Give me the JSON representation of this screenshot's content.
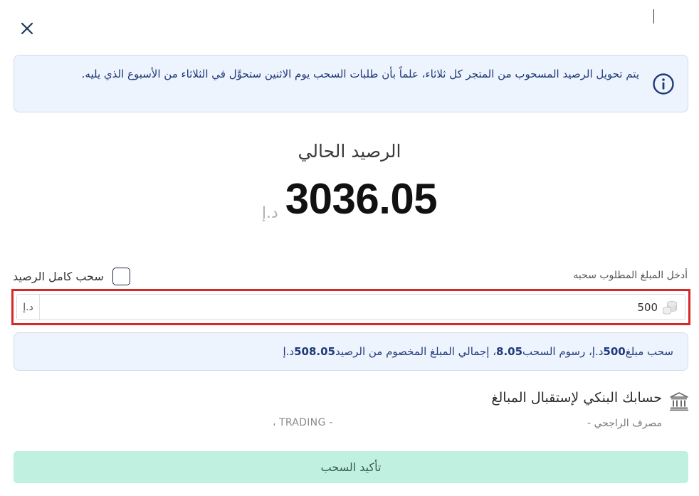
{
  "info": {
    "message": "يتم تحويل الرصيد المسحوب من المتجر كل ثلاثاء، علماً بأن طلبات السحب يوم الاثنين ستحوَّل في الثلاثاء من الأسبوع الذي يليه."
  },
  "balance": {
    "label": "الرصيد الحالي",
    "amount": "3036.05",
    "currency": "د.إ"
  },
  "withdraw": {
    "amount_label": "أدخل المبلغ المطلوب سحبه",
    "full_balance_label": "سحب كامل الرصيد",
    "amount_value": "500",
    "currency_suffix": "د.إ"
  },
  "summary": {
    "p1": "سحب مبلغ ",
    "amount": "500",
    "p2": " د.إ، رسوم السحب ",
    "fee": "8.05",
    "p3": " ، إجمالي المبلغ المخصوم من الرصيد ",
    "total": "508.05",
    "p4": " د.إ"
  },
  "bank": {
    "title": "حسابك البنكي لإستقبال المبالغ",
    "name": "مصرف الراجحي -",
    "holder": "، TRADING -"
  },
  "confirm_label": "تأكيد السحب",
  "colors": {
    "info_bg": "#eef4fd",
    "info_text": "#1e3a78",
    "confirm_bg": "#bff0e0",
    "highlight_border": "#d62828"
  },
  "icons": [
    "close-icon",
    "info-icon",
    "coins-icon",
    "bank-icon"
  ]
}
